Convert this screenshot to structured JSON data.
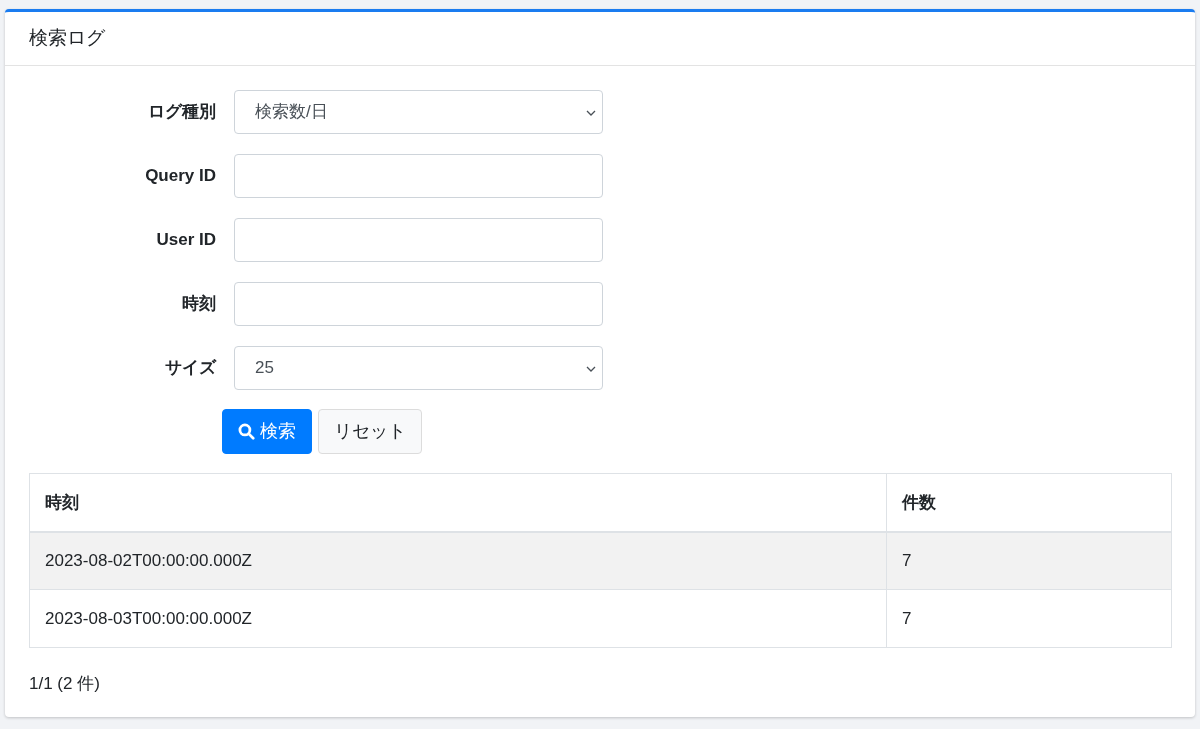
{
  "card": {
    "title": "検索ログ"
  },
  "form": {
    "fields": [
      {
        "kind": "select",
        "label": "ログ種別",
        "value": "検索数/日"
      },
      {
        "kind": "input",
        "label": "Query ID"
      },
      {
        "kind": "input",
        "label": "User ID"
      },
      {
        "kind": "input",
        "label": "時刻"
      },
      {
        "kind": "select",
        "label": "サイズ",
        "value": "25"
      }
    ],
    "buttons": [
      {
        "kind": "primary",
        "label": "検索"
      },
      {
        "kind": "secondary",
        "label": "リセット"
      }
    ]
  },
  "table": {
    "columns": [
      "時刻",
      "件数"
    ],
    "rows": [
      [
        "2023-08-02T00:00:00.000Z",
        "7"
      ],
      [
        "2023-08-03T00:00:00.000Z",
        "7"
      ]
    ]
  },
  "pagination": "1/1 (2 件)"
}
